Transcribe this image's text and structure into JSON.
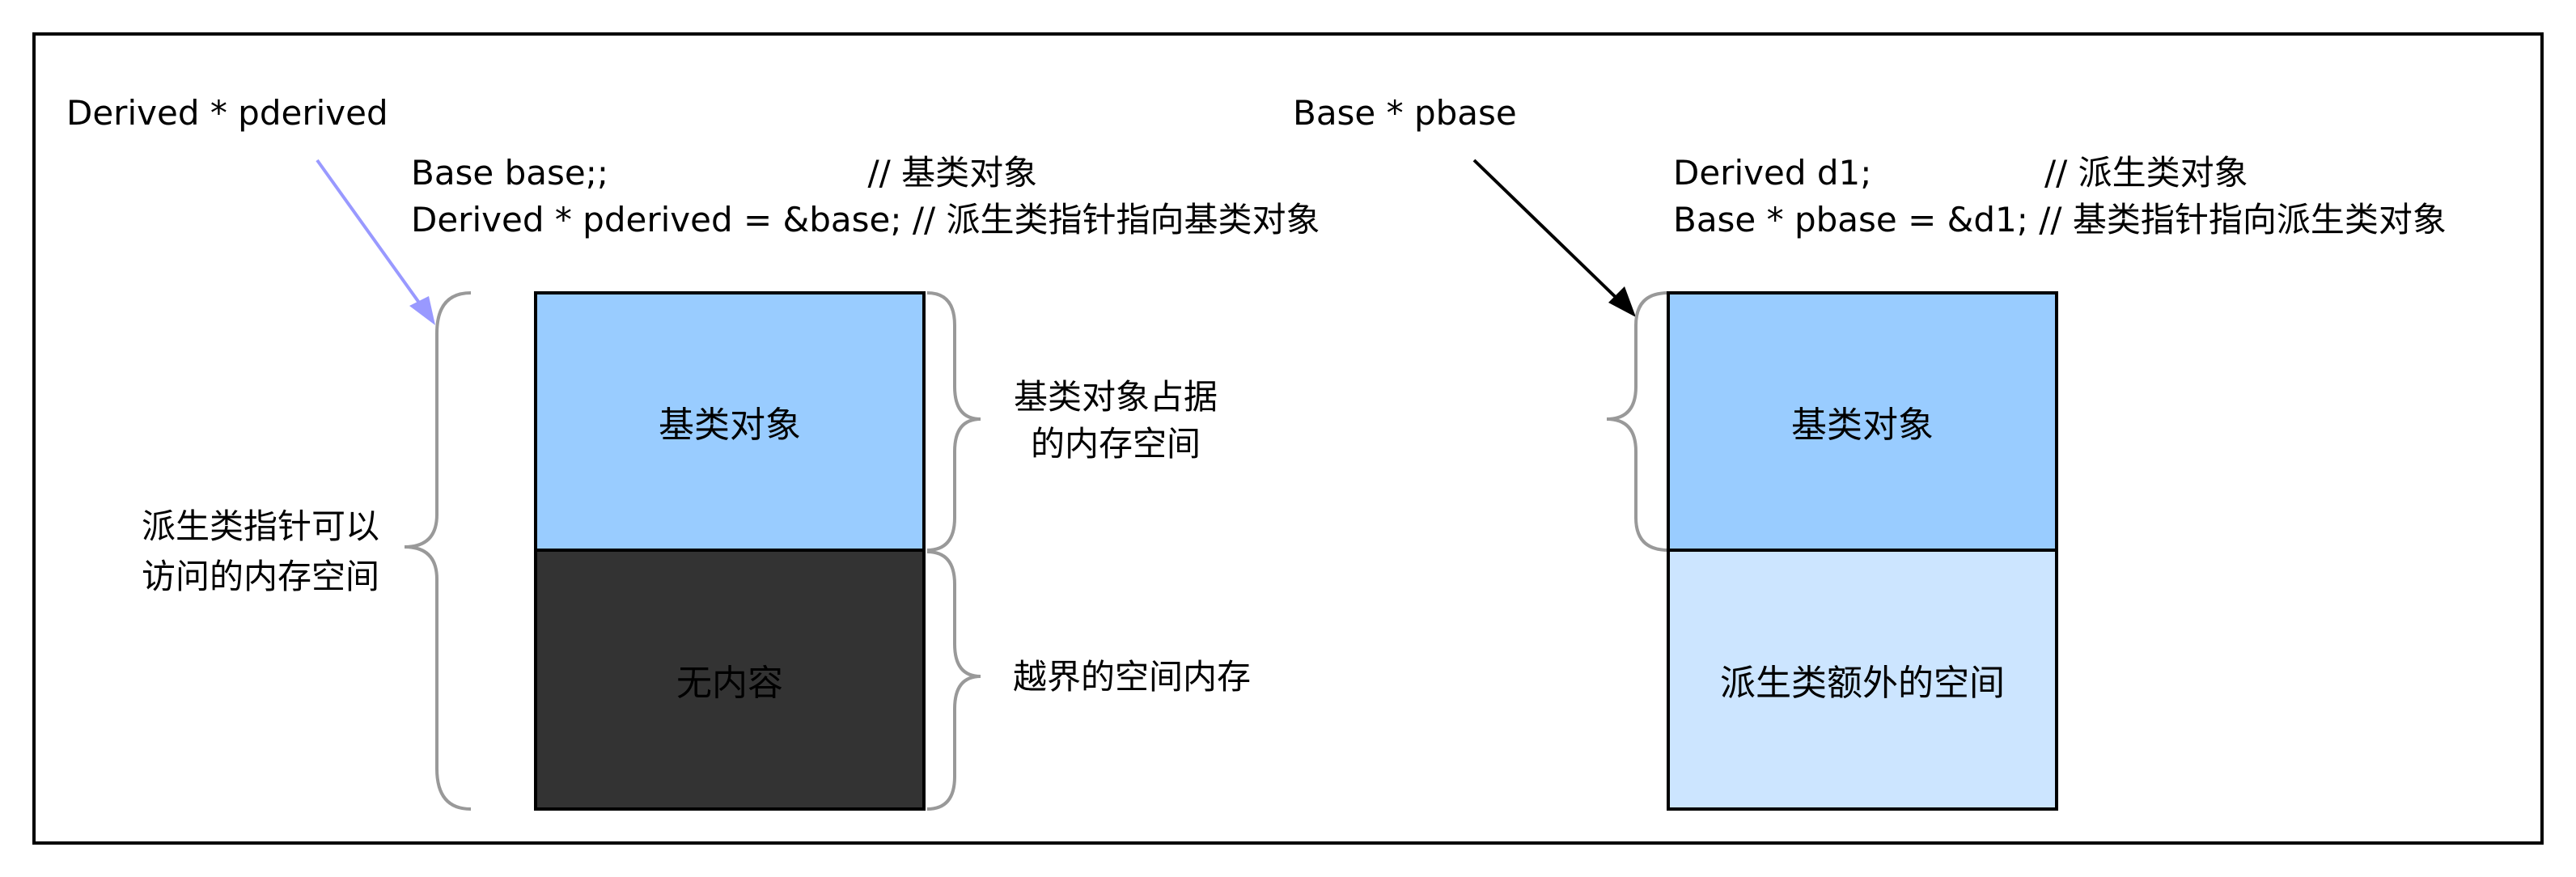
{
  "left": {
    "pointer_label": "Derived * pderived",
    "code_line1": "Base base;;                        // 基类对象",
    "code_line2": "Derived * pderived = &base; // 派生类指针指向基类对象",
    "box_top_label": "基类对象",
    "box_bottom_label": "无内容",
    "brace_label_line1": "派生类指针可以",
    "brace_label_line2": "访问的内存空间",
    "right_brace_top_line1": "基类对象占据",
    "right_brace_top_line2": "的内存空间",
    "right_brace_bottom": "越界的空间内存"
  },
  "right": {
    "pointer_label": "Base * pbase",
    "code_line1": "Derived d1;                // 派生类对象",
    "code_line2": "Base * pbase = &d1; // 基类指针指向派生类对象",
    "box_top_label": "基类对象",
    "box_bottom_label": "派生类额外的空间"
  },
  "colors": {
    "base_box_left": "#99ccff",
    "base_box_right": "#99ccff",
    "empty_box": "#333333",
    "extra_box": "#cce5ff",
    "arrow_left": "#9999ff",
    "arrow_right": "#000000",
    "brace": "#999999"
  }
}
